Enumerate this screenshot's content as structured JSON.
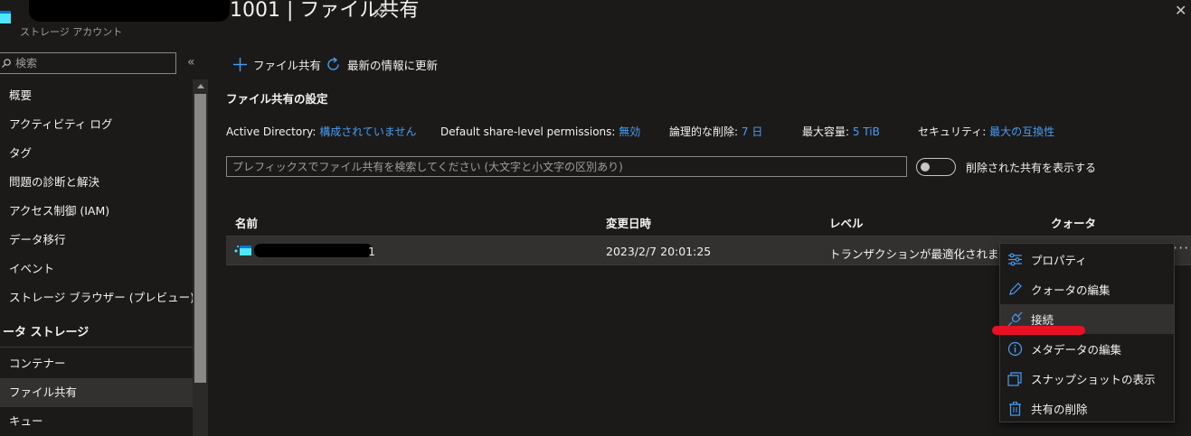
{
  "header": {
    "title_visible_suffix": "1001 | ファイル共有",
    "subtitle": "ストレージ アカウント",
    "more_icon": "more-icon",
    "pin_icon": "pin-icon",
    "close_icon": "close-icon"
  },
  "sidebar": {
    "search_placeholder": "検索",
    "collapse_glyph": "«",
    "items": [
      {
        "label": "概要"
      },
      {
        "label": "アクティビティ ログ"
      },
      {
        "label": "タグ"
      },
      {
        "label": "問題の診断と解決"
      },
      {
        "label": "アクセス制御 (IAM)"
      },
      {
        "label": "データ移行"
      },
      {
        "label": "イベント"
      },
      {
        "label": "ストレージ ブラウザー (プレビュー)"
      }
    ],
    "section": "ータ ストレージ",
    "section_items": [
      {
        "label": "コンテナー"
      },
      {
        "label": "ファイル共有",
        "active": true
      },
      {
        "label": "キュー"
      }
    ]
  },
  "toolbar": {
    "add_label": "ファイル共有",
    "refresh_label": "最新の情報に更新"
  },
  "settings": {
    "title": "ファイル共有の設定",
    "active_directory_label": "Active Directory:",
    "active_directory_value": "構成されていません",
    "share_perm_label": "Default share-level permissions:",
    "share_perm_value": "無効",
    "soft_delete_label": "論理的な削除:",
    "soft_delete_value": "7 日",
    "max_capacity_label": "最大容量:",
    "max_capacity_value": "5 TiB",
    "security_label": "セキュリティ:",
    "security_value": "最大の互換性"
  },
  "filter": {
    "placeholder": "プレフィックスでファイル共有を検索してください (大文字と小文字の区別あり)",
    "toggle_label": "削除された共有を表示する",
    "toggle_on": false
  },
  "table": {
    "columns": [
      "名前",
      "変更日時",
      "レベル",
      "クォータ"
    ],
    "rows": [
      {
        "name_visible_suffix": "1",
        "modified": "2023/2/7 20:01:25",
        "tier": "トランザクションが最適化されました"
      }
    ]
  },
  "context_menu": {
    "items": [
      {
        "label": "プロパティ",
        "icon": "properties-icon"
      },
      {
        "label": "クォータの編集",
        "icon": "edit-pencil-icon"
      },
      {
        "label": "接続",
        "icon": "connect-plug-icon",
        "hover": true
      },
      {
        "label": "メタデータの編集",
        "icon": "info-icon"
      },
      {
        "label": "スナップショットの表示",
        "icon": "snapshot-icon"
      },
      {
        "label": "共有の削除",
        "icon": "trash-icon"
      }
    ]
  },
  "colors": {
    "background": "#1b1a19",
    "link": "#479ef5",
    "row_hover": "#323130",
    "annotation_red": "#e81123"
  }
}
